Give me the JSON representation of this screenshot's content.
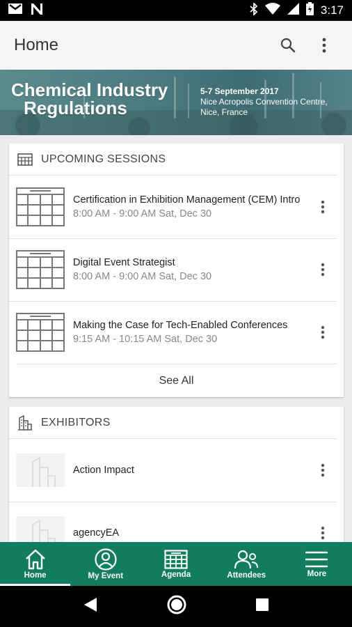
{
  "status_bar": {
    "time": "3:17"
  },
  "app_bar": {
    "title": "Home"
  },
  "banner": {
    "title_line1": "Chemical Industry",
    "title_line2": "Regulations",
    "dates": "5-7 September 2017",
    "venue": "Nice Acropolis Convention Centre,",
    "city": "Nice, France"
  },
  "sessions": {
    "header": "UPCOMING SESSIONS",
    "items": [
      {
        "title": "Certification in Exhibition Management (CEM) Intro",
        "time": "8:00 AM - 9:00 AM Sat, Dec 30"
      },
      {
        "title": "Digital Event Strategist",
        "time": "8:00 AM - 9:00 AM Sat, Dec 30"
      },
      {
        "title": "Making the Case for Tech-Enabled Conferences",
        "time": "9:15 AM - 10:15 AM Sat, Dec 30"
      }
    ],
    "see_all": "See All"
  },
  "exhibitors": {
    "header": "EXHIBITORS",
    "items": [
      {
        "name": "Action Impact"
      },
      {
        "name": "agencyEA"
      }
    ]
  },
  "bottom_nav": {
    "items": [
      {
        "label": "Home",
        "icon": "home-icon",
        "active": true
      },
      {
        "label": "My Event",
        "icon": "person-icon",
        "active": false
      },
      {
        "label": "Agenda",
        "icon": "calendar-icon",
        "active": false
      },
      {
        "label": "Attendees",
        "icon": "people-icon",
        "active": false
      },
      {
        "label": "More",
        "icon": "menu-icon",
        "active": false
      }
    ]
  },
  "colors": {
    "accent": "#127d5d",
    "status_bar": "#000000",
    "app_bar": "#f5f5f5"
  }
}
